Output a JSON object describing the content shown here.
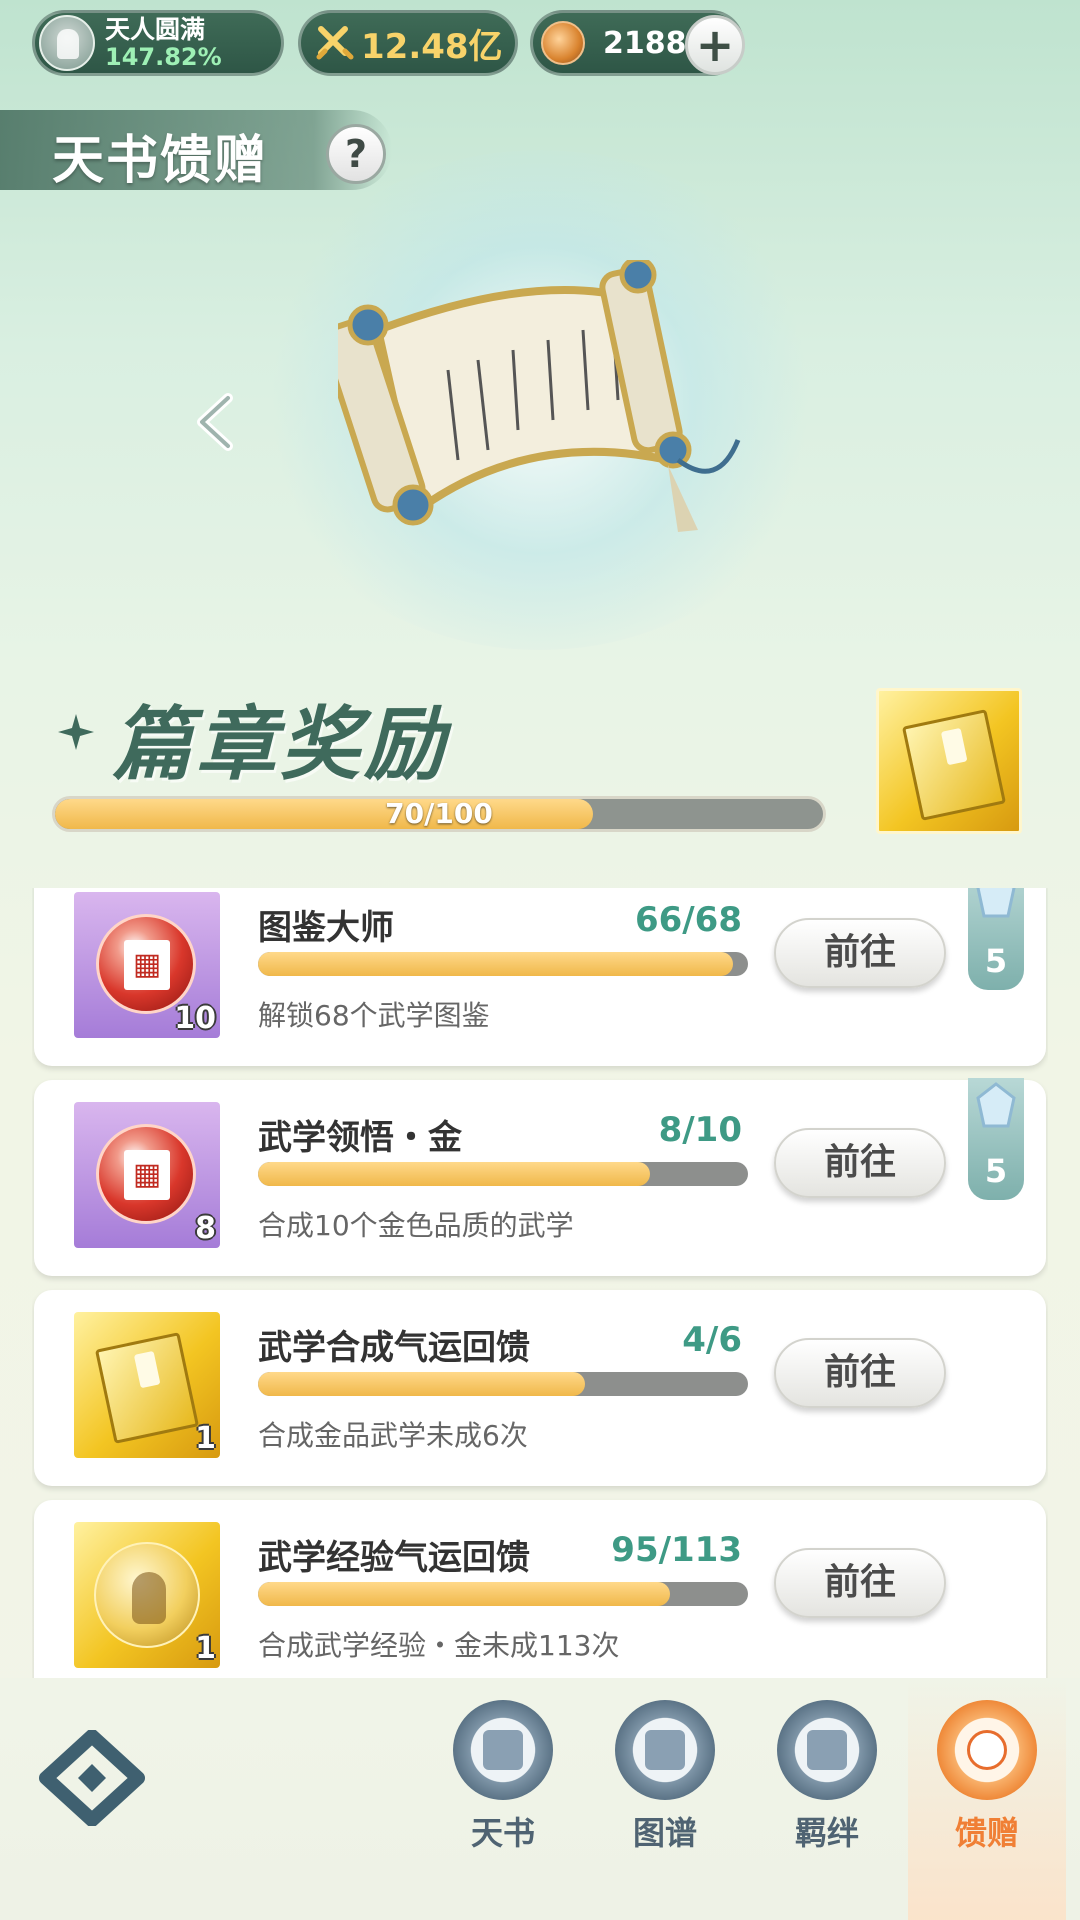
{
  "header": {
    "realm_name": "天人圆满",
    "realm_percent": "147.82%",
    "power_value": "12.48亿",
    "coin_value": "21884",
    "add_symbol": "+"
  },
  "page": {
    "title": "天书馈赠",
    "help_symbol": "?"
  },
  "chapter": {
    "title": "篇章奖励",
    "progress_text": "70/100",
    "progress_fraction": 0.7
  },
  "tasks": [
    {
      "title": "图鉴大师",
      "progress_text": "66/68",
      "progress_fraction": 0.97,
      "description": "解锁68个武学图鉴",
      "icon": "red-seal-orb-icon",
      "icon_count": "10",
      "button_label": "前往",
      "gem_reward": "5"
    },
    {
      "title": "武学领悟・金",
      "progress_text": "8/10",
      "progress_fraction": 0.8,
      "description": "合成10个金色品质的武学",
      "icon": "red-seal-orb-icon",
      "icon_count": "8",
      "button_label": "前往",
      "gem_reward": "5"
    },
    {
      "title": "武学合成气运回馈",
      "progress_text": "4/6",
      "progress_fraction": 0.667,
      "description": "合成金品武学未成6次",
      "icon": "golden-book-icon",
      "icon_count": "1",
      "button_label": "前往"
    },
    {
      "title": "武学经验气运回馈",
      "progress_text": "95/113",
      "progress_fraction": 0.84,
      "description": "合成武学经验・金未成113次",
      "icon": "meditation-orb-icon",
      "icon_count": "1",
      "button_label": "前往"
    }
  ],
  "bottom_nav": {
    "items": [
      {
        "label": "天书",
        "icon": "book-emblem-icon"
      },
      {
        "label": "图谱",
        "icon": "map-emblem-icon"
      },
      {
        "label": "羁绊",
        "icon": "handshake-emblem-icon"
      },
      {
        "label": "馈赠",
        "icon": "gift-bag-emblem-icon",
        "active": true
      }
    ]
  },
  "colors": {
    "accent_green": "#3e9a85",
    "progress_gold": "#f0b84a",
    "active_orange": "#f07f35"
  }
}
